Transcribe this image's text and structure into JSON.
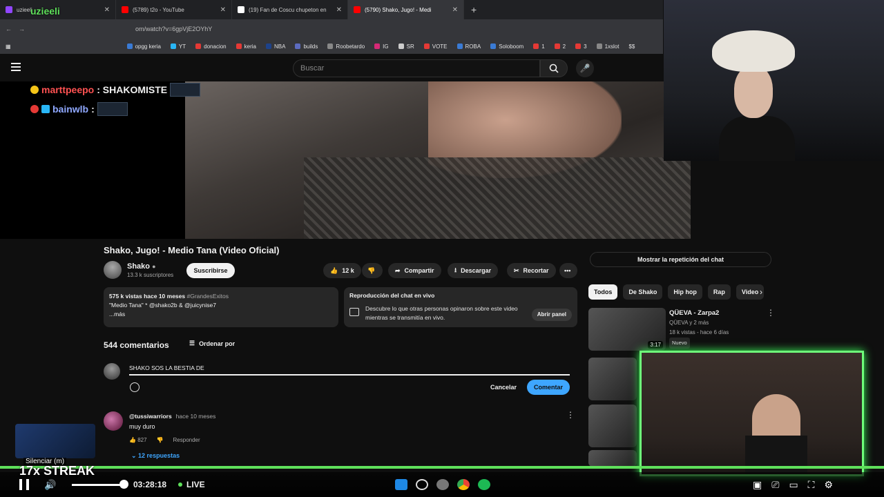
{
  "browser": {
    "tabs": [
      {
        "label": "uzieeli",
        "color": "#9146ff",
        "active": false
      },
      {
        "label": "(5789) t2o - YouTube",
        "color": "#ff0000",
        "active": false
      },
      {
        "label": "(19) Fan de Coscu chupeton en",
        "color": "#ffffff",
        "active": false
      },
      {
        "label": "(5790) Shako, Jugo! - Medi",
        "color": "#ff0000",
        "active": true
      }
    ],
    "url": "om/watch?v=6gpVjE2OYhY",
    "bookmarks": [
      "opgg keria",
      "YT",
      "donacion",
      "keria",
      "NBA",
      "builds",
      "Roobetardo",
      "IG",
      "SR",
      "VOTE",
      "ROBA",
      "Soloboom",
      "1",
      "2",
      "3",
      "1xslot",
      "$$"
    ]
  },
  "youtube": {
    "search_placeholder": "Buscar",
    "video_title": "Shako, Jugo! - Medio Tana (Video Oficial)",
    "channel": {
      "name": "Shako",
      "subs": "13.3 k suscriptores"
    },
    "subscribe_label": "Suscribirse",
    "likes": "12 k",
    "share_label": "Compartir",
    "download_label": "Descargar",
    "clip_label": "Recortar",
    "description": {
      "stats": "575 k vistas  hace 10 meses",
      "tags": "#GrandesExitos",
      "text": "\"Medio Tana\" * @shako2b & @juicynise7",
      "more": "...más"
    },
    "live_chat": {
      "heading": "Reproducción del chat en vivo",
      "text": "Descubre lo que otras personas opinaron sobre este video mientras se transmitía en vivo.",
      "open_label": "Abrir panel"
    },
    "comments_count": "544 comentarios",
    "sort_label": "Ordenar por",
    "comment_draft": "SHAKO SOS LA BESTIA DE",
    "cancel_label": "Cancelar",
    "submit_label": "Comentar",
    "comment": {
      "user": "@tussiwarriors",
      "time": "hace 10 meses",
      "text": "muy duro",
      "likes": "827",
      "reply_label": "Responder",
      "replies": "12 respuestas"
    },
    "replay_label": "Mostrar la repetición del chat",
    "chips": [
      "Todos",
      "De Shako",
      "Hip hop",
      "Rap",
      "Video"
    ],
    "recommendation": {
      "title": "QÜEVA - Zarpa2",
      "channel": "QÜEVA y 2 más",
      "meta": "18 k vistas - hace 6 días",
      "badge": "Nuevo",
      "duration": "3:17"
    }
  },
  "stream_chat": [
    {
      "user": "marttpeepo",
      "message": ": SHAKOMISTE",
      "color": "#ff5252"
    },
    {
      "user": "bainwlb",
      "message": ":",
      "color": "#8fa8ff"
    }
  ],
  "player": {
    "time": "03:28:18",
    "live_label": "LIVE",
    "mute_tooltip": "Silenciar (m)",
    "streak": "17x STREAK",
    "accent": "#5fe05b"
  }
}
